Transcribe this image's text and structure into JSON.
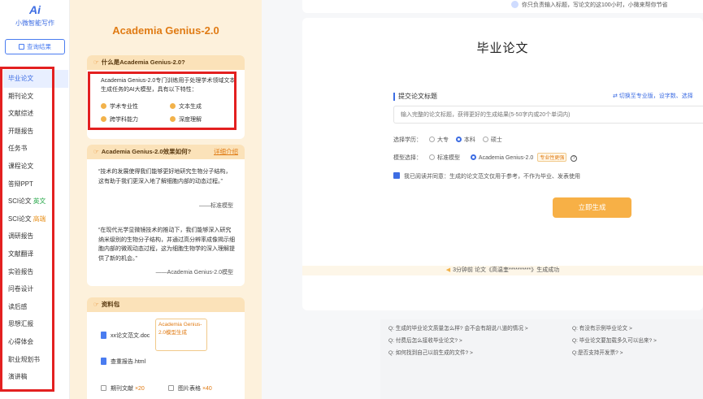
{
  "sidebar": {
    "logo_mark": "Ai",
    "logo_text": "小微智能写作",
    "query_button": "查询结果",
    "items": [
      {
        "label": "毕业论文",
        "tag": ""
      },
      {
        "label": "期刊论文",
        "tag": ""
      },
      {
        "label": "文献综述",
        "tag": ""
      },
      {
        "label": "开题报告",
        "tag": ""
      },
      {
        "label": "任务书",
        "tag": ""
      },
      {
        "label": "课程论文",
        "tag": ""
      },
      {
        "label": "答辩PPT",
        "tag": ""
      },
      {
        "label": "SCI论文",
        "tag": "英文"
      },
      {
        "label": "SCI论文",
        "tag": "高端"
      },
      {
        "label": "调研报告",
        "tag": ""
      },
      {
        "label": "文献翻译",
        "tag": ""
      },
      {
        "label": "实验报告",
        "tag": ""
      },
      {
        "label": "问卷设计",
        "tag": ""
      },
      {
        "label": "读后感",
        "tag": ""
      },
      {
        "label": "思想汇报",
        "tag": ""
      },
      {
        "label": "心得体会",
        "tag": ""
      },
      {
        "label": "职业规划书",
        "tag": ""
      },
      {
        "label": "演讲稿",
        "tag": ""
      }
    ]
  },
  "promo": {
    "title": "Academia Genius-2.0",
    "what_card": {
      "heading": "什么是Academia Genius-2.0?",
      "description": "Academia Genius-2.0专门训练用于处理学术领域文本生成任务的AI大模型，具有以下特性：",
      "features": [
        "学术专业性",
        "文本生成",
        "跨学科能力",
        "深度理解"
      ]
    },
    "effect_card": {
      "heading": "Academia Genius-2.0效果如何?",
      "detail_link": "详细介绍",
      "quote1": "“技术的发展使得我们能够更好地研究生物分子结构，这有助于我们更深入地了解细胞内部的动态过程。”",
      "sig1": "——标准模型",
      "quote2": "“在现代光学显微镜技术的推动下，我们能够深入研究纳米级别的生物分子结构，并通过高分辨率成像揭示细胞内部的微观动态过程，这为细胞生物学的深入理解提供了新的机会。”",
      "sig2": "——Academia Genius-2.0模型"
    },
    "pack_card": {
      "heading": "资料包",
      "file1": "xx论文范文.doc",
      "file2": "查重报告.html",
      "tooltip": "Academia Genius-2.0模型生成",
      "stat1_label": "期刊文献",
      "stat1_count": "×20",
      "stat2_label": "图片表格",
      "stat2_count": "×40"
    }
  },
  "main": {
    "top_tip": "你只负责输入标题，写论文的这100小时，小微来帮你节省",
    "page_title": "毕业论文",
    "section_label": "提交论文标题",
    "switch_link": "⇄ 切换至专业版，设字数、选择",
    "title_placeholder": "输入完整的论文标题，获得更好的生成结果(5-50字内或20个单词内)",
    "education_label": "选择学历：",
    "education_options": [
      "大专",
      "本科",
      "硕士"
    ],
    "education_selected": "本科",
    "model_label": "模型选择：",
    "model_options": [
      "标准模型",
      "Academia Genius-2.0"
    ],
    "model_badge": "专业性更强",
    "help_icon": "?",
    "agreement": "我已阅读并同意：生成的论文范文仅用于参考，不作为毕业、发表使用",
    "generate_button": "立即生成",
    "notice": "3分钟前 论文《高温奎**********》生成成功",
    "faq": [
      "Q: 生成的毕业论文质量怎么样? 会不会有胡说八道的情况 >",
      "Q: 有没有示例毕业论文 >",
      "Q: 付费后怎么接收毕业论文? >",
      "Q: 毕业论文要加载多久可以出来? >",
      "Q: 如何找到自己以前生成的文件? >",
      "Q:是否支持开发票? >"
    ]
  },
  "colors": {
    "accent_blue": "#3d6de3",
    "accent_orange": "#e07b14",
    "annotation_red": "#e32020"
  }
}
